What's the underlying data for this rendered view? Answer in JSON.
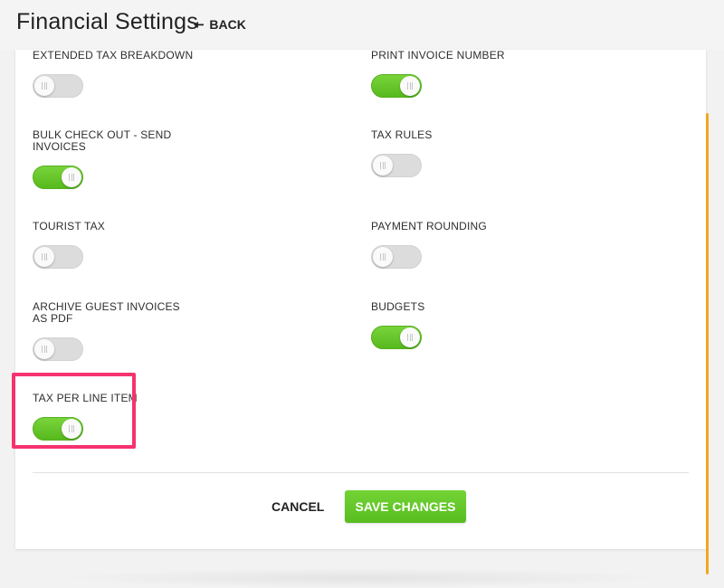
{
  "header": {
    "title": "Financial Settings",
    "back_label": "BACK"
  },
  "settings": [
    {
      "label": "EXTENDED TAX BREAKDOWN",
      "enabled": false
    },
    {
      "label": "PRINT INVOICE NUMBER",
      "enabled": true
    },
    {
      "label": "BULK CHECK OUT - SEND INVOICES",
      "enabled": true
    },
    {
      "label": "TAX RULES",
      "enabled": false
    },
    {
      "label": "TOURIST TAX",
      "enabled": false
    },
    {
      "label": "PAYMENT ROUNDING",
      "enabled": false
    },
    {
      "label": "ARCHIVE GUEST INVOICES AS PDF",
      "enabled": false
    },
    {
      "label": "BUDGETS",
      "enabled": true
    },
    {
      "label": "TAX PER LINE ITEM",
      "enabled": true
    }
  ],
  "footer": {
    "cancel_label": "CANCEL",
    "save_label": "SAVE CHANGES"
  },
  "colors": {
    "toggle_on": "#5cc024",
    "toggle_off": "#dcdcdc",
    "highlight": "#f5336e",
    "scrollbar": "#f3a61d"
  }
}
